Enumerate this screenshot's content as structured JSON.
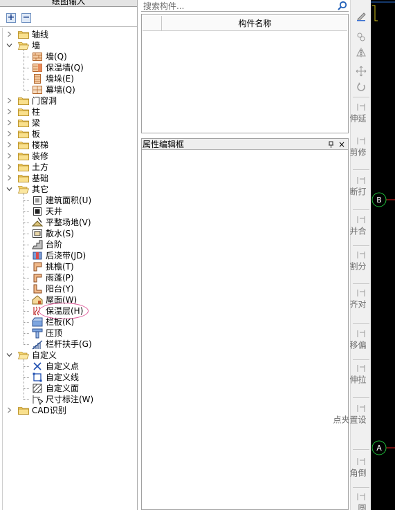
{
  "left_panel": {
    "title": "绘图输入",
    "toolbar": {
      "expand_label": "+",
      "collapse_label": "−"
    },
    "tree": [
      {
        "label": "轴线",
        "expanded": false
      },
      {
        "label": "墙",
        "expanded": true,
        "children": [
          "墙(Q)",
          "保温墙(Q)",
          "墙垛(E)",
          "幕墙(Q)"
        ]
      },
      {
        "label": "门窗洞",
        "expanded": false
      },
      {
        "label": "柱",
        "expanded": false
      },
      {
        "label": "梁",
        "expanded": false
      },
      {
        "label": "板",
        "expanded": false
      },
      {
        "label": "楼梯",
        "expanded": false
      },
      {
        "label": "装修",
        "expanded": false
      },
      {
        "label": "土方",
        "expanded": false
      },
      {
        "label": "基础",
        "expanded": false
      },
      {
        "label": "其它",
        "expanded": true,
        "children": [
          "建筑面积(U)",
          "天井",
          "平整场地(V)",
          "散水(S)",
          "台阶",
          "后浇带(JD)",
          "挑檐(T)",
          "雨蓬(P)",
          "阳台(Y)",
          "屋面(W)",
          "保温层(H)",
          "栏板(K)",
          "压顶",
          "栏杆扶手(G)"
        ]
      },
      {
        "label": "自定义",
        "expanded": true,
        "children": [
          "自定义点",
          "自定义线",
          "自定义面",
          "尺寸标注(W)"
        ]
      },
      {
        "label": "CAD识别",
        "expanded": false
      }
    ],
    "highlighted_item": "保温层(H)"
  },
  "middle_panel": {
    "search": {
      "placeholder": "搜索构件..."
    },
    "component_list": {
      "column_header": "构件名称"
    },
    "property_panel": {
      "title": "属性编辑框",
      "pin_label": "ᵖ",
      "close_label": "×"
    }
  },
  "right_toolbar": {
    "items": [
      {
        "icon": "brush-icon",
        "label": ""
      },
      {
        "icon": "copy-icon",
        "label": ""
      },
      {
        "icon": "mirror-icon",
        "label": ""
      },
      {
        "icon": "move-icon",
        "label": ""
      },
      {
        "icon": "rotate-icon",
        "label": ""
      },
      {
        "icon": "extend-icon",
        "label": "延伸"
      },
      {
        "icon": "trim-icon",
        "label": "修剪"
      },
      {
        "icon": "break-icon",
        "label": "打断"
      },
      {
        "icon": "merge-icon",
        "label": "合并"
      },
      {
        "icon": "split-icon",
        "label": "分割"
      },
      {
        "icon": "align-icon",
        "label": "对齐"
      },
      {
        "icon": "offset-icon",
        "label": "偏移"
      },
      {
        "icon": "stretch-icon",
        "label": "拉伸"
      },
      {
        "icon": "grip-icon",
        "label": "设置夹点"
      },
      {
        "icon": "chamfer-icon",
        "label": "倒角"
      },
      {
        "icon": "fillet-icon",
        "label": "圆"
      }
    ]
  },
  "canvas": {
    "axis_markers": [
      "B",
      "A"
    ],
    "colors": {
      "background": "#000000",
      "axis_circle": "#1fbf3a",
      "axis_line": "#e02020",
      "boundary": "#d4c21a"
    }
  }
}
